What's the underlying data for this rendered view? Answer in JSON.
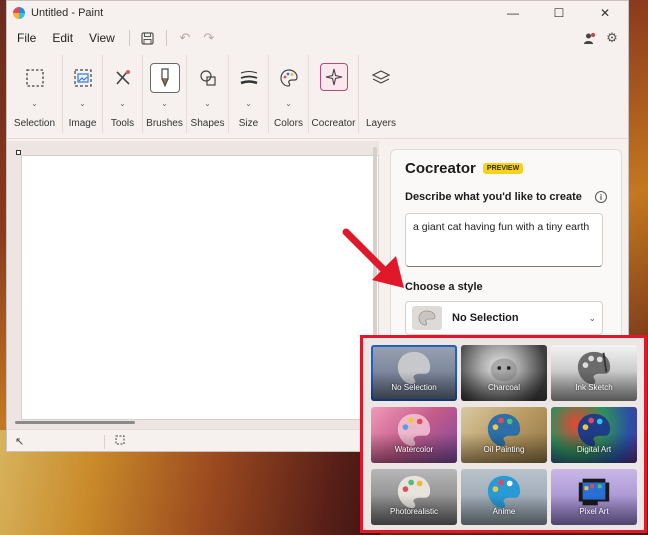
{
  "window": {
    "title": "Untitled - Paint"
  },
  "menu": {
    "file": "File",
    "edit": "Edit",
    "view": "View"
  },
  "ribbon": {
    "groups": [
      "Selection",
      "Image",
      "Tools",
      "Brushes",
      "Shapes",
      "Size",
      "Colors",
      "Cocreator",
      "Layers"
    ]
  },
  "cocreator": {
    "title": "Cocreator",
    "badge": "PREVIEW",
    "describe_label": "Describe what you'd like to create",
    "prompt_value": "a giant cat having fun with a tiny earth",
    "style_label": "Choose a style",
    "style_value": "No Selection"
  },
  "styles": [
    "No Selection",
    "Charcoal",
    "Ink Sketch",
    "Watercolor",
    "Oil Painting",
    "Digital Art",
    "Photorealistic",
    "Anime",
    "Pixel Art"
  ],
  "colors": {
    "highlight": "#e1182a",
    "accent": "#1f5fc9",
    "badge": "#f5d21f"
  }
}
